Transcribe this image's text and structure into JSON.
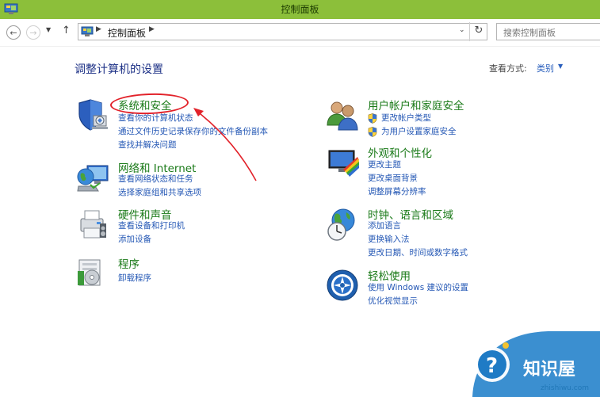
{
  "window": {
    "title": "控制面板"
  },
  "nav": {
    "back_icon": "arrow-left-icon",
    "forward_icon": "arrow-right-icon",
    "up_icon": "arrow-up-icon"
  },
  "address": {
    "path": "控制面板"
  },
  "search": {
    "placeholder": "搜索控制面板"
  },
  "main": {
    "heading": "调整计算机的设置",
    "viewby_label": "查看方式:",
    "viewby_value": "类别"
  },
  "categories": [
    {
      "title": "系统和安全",
      "icon": "shield-computer-icon",
      "links": [
        "查看你的计算机状态",
        "通过文件历史记录保存你的文件备份副本",
        "查找并解决问题"
      ]
    },
    {
      "title": "网络和 Internet",
      "icon": "network-globe-icon",
      "links": [
        "查看网络状态和任务",
        "选择家庭组和共享选项"
      ]
    },
    {
      "title": "硬件和声音",
      "icon": "printer-icon",
      "links": [
        "查看设备和打印机",
        "添加设备"
      ]
    },
    {
      "title": "程序",
      "icon": "programs-box-icon",
      "links": [
        "卸载程序"
      ]
    },
    {
      "title": "用户帐户和家庭安全",
      "icon": "users-icon",
      "links": [
        "更改帐户类型",
        "为用户设置家庭安全"
      ]
    },
    {
      "title": "外观和个性化",
      "icon": "monitor-paint-icon",
      "links": [
        "更改主题",
        "更改桌面背景",
        "调整屏幕分辨率"
      ]
    },
    {
      "title": "时钟、语言和区域",
      "icon": "globe-clock-icon",
      "links": [
        "添加语言",
        "更换输入法",
        "更改日期、时间或数字格式"
      ]
    },
    {
      "title": "轻松使用",
      "icon": "ease-of-access-icon",
      "links": [
        "使用 Windows 建议的设置",
        "优化视觉显示"
      ]
    }
  ],
  "watermark": {
    "brand": "知识屋",
    "url": "zhishiwu.com"
  },
  "colors": {
    "titlebar": "#8cbf3a",
    "category_title": "#1a7a18",
    "link": "#2558b5",
    "heading": "#1e3287",
    "annotation": "#e2222a"
  }
}
